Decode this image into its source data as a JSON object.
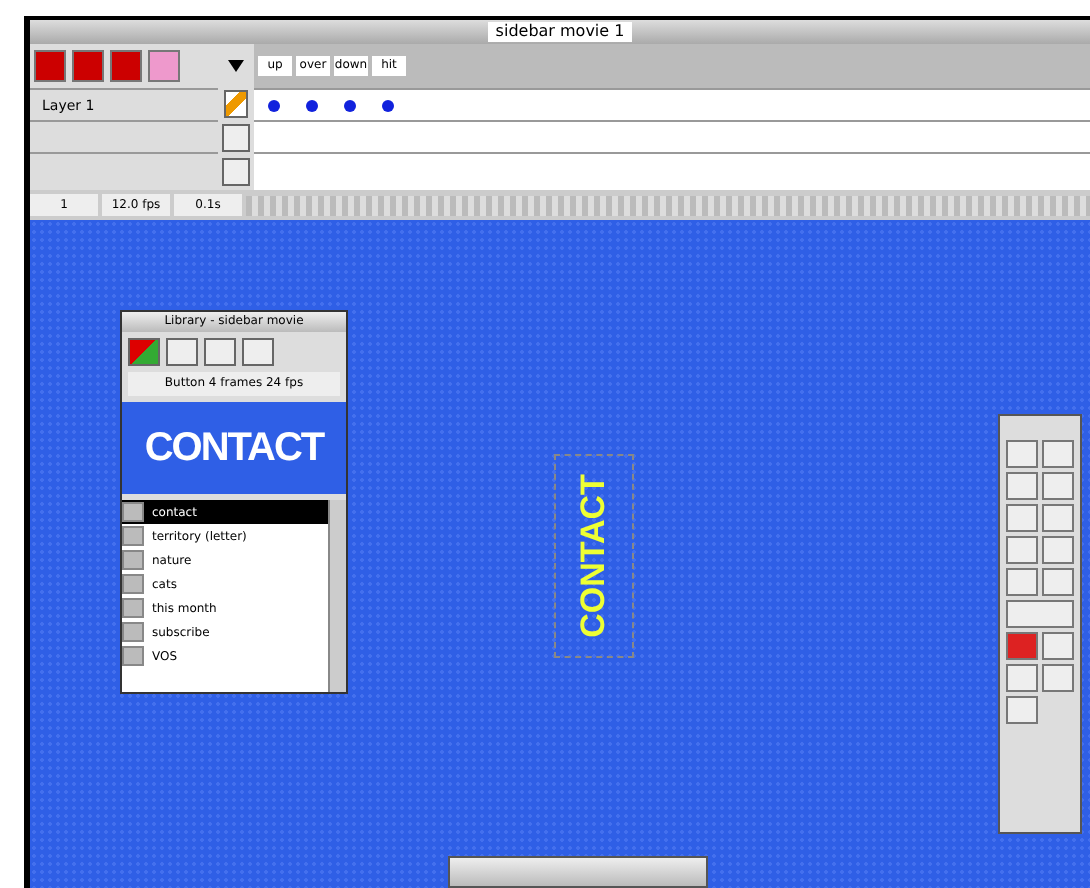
{
  "window": {
    "title": "sidebar movie 1"
  },
  "timeline": {
    "frame_labels": [
      "up",
      "over",
      "down",
      "hit"
    ],
    "layers": [
      {
        "name": "Layer 1",
        "keyframes": [
          true,
          true,
          true,
          true
        ]
      }
    ],
    "status": [
      "1",
      "12.0 fps",
      "0.1s"
    ]
  },
  "library": {
    "title": "Library - sidebar movie",
    "info": "Button 4 frames 24 fps",
    "preview_text": "CONTACT",
    "items": [
      {
        "label": "contact",
        "selected": true
      },
      {
        "label": "territory (letter)",
        "selected": false
      },
      {
        "label": "nature",
        "selected": false
      },
      {
        "label": "cats",
        "selected": false
      },
      {
        "label": "this month",
        "selected": false
      },
      {
        "label": "subscribe",
        "selected": false
      },
      {
        "label": "VOS",
        "selected": false
      }
    ]
  },
  "stage": {
    "symbol_text": "CONTACT"
  }
}
